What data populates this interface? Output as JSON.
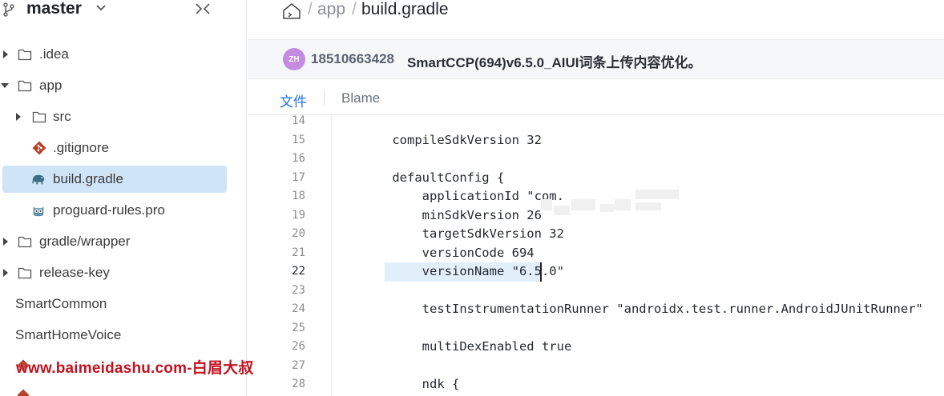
{
  "sidebar": {
    "branch": "master",
    "items": [
      {
        "label": ".idea",
        "type": "folder",
        "expanded": false
      },
      {
        "label": "app",
        "type": "folder",
        "expanded": true
      },
      {
        "label": "src",
        "type": "folder",
        "expanded": false
      },
      {
        "label": ".gitignore",
        "type": "git-file"
      },
      {
        "label": "build.gradle",
        "type": "gradle-file",
        "selected": true
      },
      {
        "label": "proguard-rules.pro",
        "type": "proguard-file"
      },
      {
        "label": "gradle/wrapper",
        "type": "folder",
        "expanded": false
      },
      {
        "label": "release-key",
        "type": "folder",
        "expanded": false
      },
      {
        "label": "SmartCommon",
        "type": "item"
      },
      {
        "label": "SmartHomeVoice",
        "type": "item"
      }
    ]
  },
  "watermark": "www.baimeidashu.com-白眉大叔",
  "breadcrumb": {
    "separator": "/",
    "folder": "app",
    "file": "build.gradle"
  },
  "commit": {
    "avatar_initials": "ZH",
    "avatar_color": "#c58be0",
    "author": "18510663428",
    "message": "SmartCCP(694)v6.5.0_AIUI词条上传内容优化。"
  },
  "tabs": {
    "file": "文件",
    "blame": "Blame"
  },
  "accent_color": "#1f6feb",
  "code": {
    "active_line": 22,
    "lines": [
      {
        "n": "14",
        "text": ""
      },
      {
        "n": "15",
        "text": "    compileSdkVersion 32"
      },
      {
        "n": "16",
        "text": ""
      },
      {
        "n": "17",
        "text": "    defaultConfig {"
      },
      {
        "n": "18",
        "text": "        applicationId \"com."
      },
      {
        "n": "19",
        "text": "        minSdkVersion 26"
      },
      {
        "n": "20",
        "text": "        targetSdkVersion 32"
      },
      {
        "n": "21",
        "text": "        versionCode 694"
      },
      {
        "n": "22",
        "text": "        versionName \"6.5.0\""
      },
      {
        "n": "23",
        "text": ""
      },
      {
        "n": "24",
        "text": "        testInstrumentationRunner \"androidx.test.runner.AndroidJUnitRunner\""
      },
      {
        "n": "25",
        "text": ""
      },
      {
        "n": "26",
        "text": "        multiDexEnabled true"
      },
      {
        "n": "27",
        "text": ""
      },
      {
        "n": "28",
        "text": "        ndk {"
      }
    ]
  }
}
